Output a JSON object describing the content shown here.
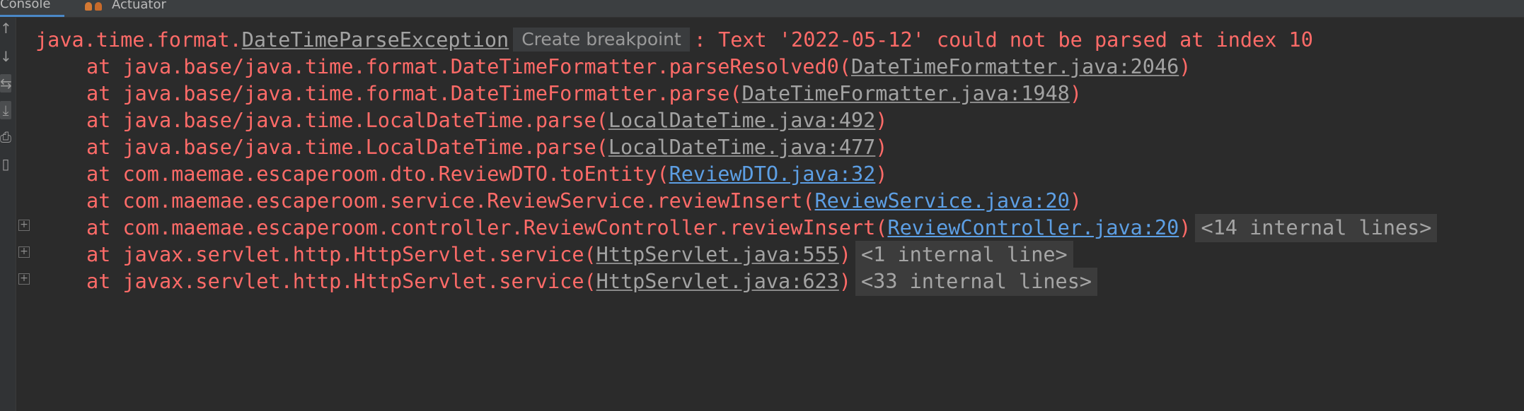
{
  "tabs": [
    {
      "label": "Console"
    },
    {
      "label": "Actuator"
    }
  ],
  "gutter_icons": [
    "up-arrow-icon",
    "down-arrow-icon",
    "soft-wrap-icon",
    "scroll-to-end-icon",
    "print-icon",
    "trash-icon"
  ],
  "exception": {
    "prefix": "java.time.format.",
    "class_link": "DateTimeParseException",
    "breakpoint_label": "Create breakpoint",
    "message": ": Text '2022-05-12' could not be parsed at index 10"
  },
  "frames": [
    {
      "text": "at java.base/java.time.format.DateTimeFormatter.parseResolved0(",
      "link": "DateTimeFormatter.java:2046",
      "close": ")",
      "internal": ""
    },
    {
      "text": "at java.base/java.time.format.DateTimeFormatter.parse(",
      "link": "DateTimeFormatter.java:1948",
      "close": ")",
      "internal": ""
    },
    {
      "text": "at java.base/java.time.LocalDateTime.parse(",
      "link": "LocalDateTime.java:492",
      "close": ")",
      "internal": ""
    },
    {
      "text": "at java.base/java.time.LocalDateTime.parse(",
      "link": "LocalDateTime.java:477",
      "close": ")",
      "internal": ""
    },
    {
      "text": "at com.maemae.escaperoom.dto.ReviewDTO.toEntity(",
      "link": "ReviewDTO.java:32",
      "close": ")",
      "internal": ""
    },
    {
      "text": "at com.maemae.escaperoom.service.ReviewService.reviewInsert(",
      "link": "ReviewService.java:20",
      "close": ")",
      "internal": ""
    },
    {
      "text": "at com.maemae.escaperoom.controller.ReviewController.reviewInsert(",
      "link": "ReviewController.java:20",
      "close": ")",
      "internal": "<14 internal lines>"
    },
    {
      "text": "at javax.servlet.http.HttpServlet.service(",
      "link": "HttpServlet.java:555",
      "close": ")",
      "internal": "<1 internal line>"
    },
    {
      "text": "at javax.servlet.http.HttpServlet.service(",
      "link": "HttpServlet.java:623",
      "close": ")",
      "internal": "<33 internal lines>"
    }
  ],
  "fold_symbol": "+",
  "colors": {
    "background": "#2b2b2b",
    "error_text": "#ff6b68",
    "project_link": "#5d9fe4",
    "library_link": "#a3a3a3"
  }
}
